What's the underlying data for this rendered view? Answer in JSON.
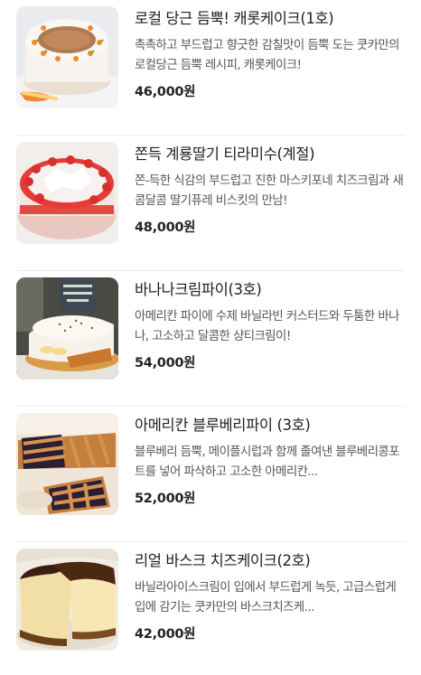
{
  "products": [
    {
      "name": "로컬 당근 듬뿍! 캐롯케이크(1호)",
      "description": "촉촉하고 부드럽고 향긋한 감칠맛이 듬뿍 도는 쿳카만의 로컬당근 듬뿍 레시피, 캐롯케이크!",
      "price": "46,000원",
      "image_icon": "carrot-cake-photo"
    },
    {
      "name": "쫀득 계룡딸기 티라미수(계절)",
      "description": "쫀-득한 식감의 부드럽고 진한 마스키포네 치즈크림과 새콤달콤 딸기퓨레 비스킷의 만남!",
      "price": "48,000원",
      "image_icon": "strawberry-tiramisu-photo"
    },
    {
      "name": "바나나크림파이(3호)",
      "description": "아메리칸 파이에 수제 바닐라빈 커스터드와 두툼한 바나나, 고소하고 달콤한 샹티크림이!",
      "price": "54,000원",
      "image_icon": "banana-cream-pie-photo"
    },
    {
      "name": "아메리칸 블루베리파이 (3호)",
      "description": "블루베리 듬뿍, 메이플시럽과 함께 졸여낸 블루베리콩포트를 넣어 파삭하고 고소한 아메리칸...",
      "price": "52,000원",
      "image_icon": "blueberry-pie-photo"
    },
    {
      "name": "리얼 바스크 치즈케이크(2호)",
      "description": "바닐라아이스크림이 입에서 부드럽게 녹듯, 고급스럽게 입에 감기는 쿳카만의 바스크치즈케...",
      "price": "42,000원",
      "image_icon": "basque-cheesecake-photo"
    }
  ]
}
